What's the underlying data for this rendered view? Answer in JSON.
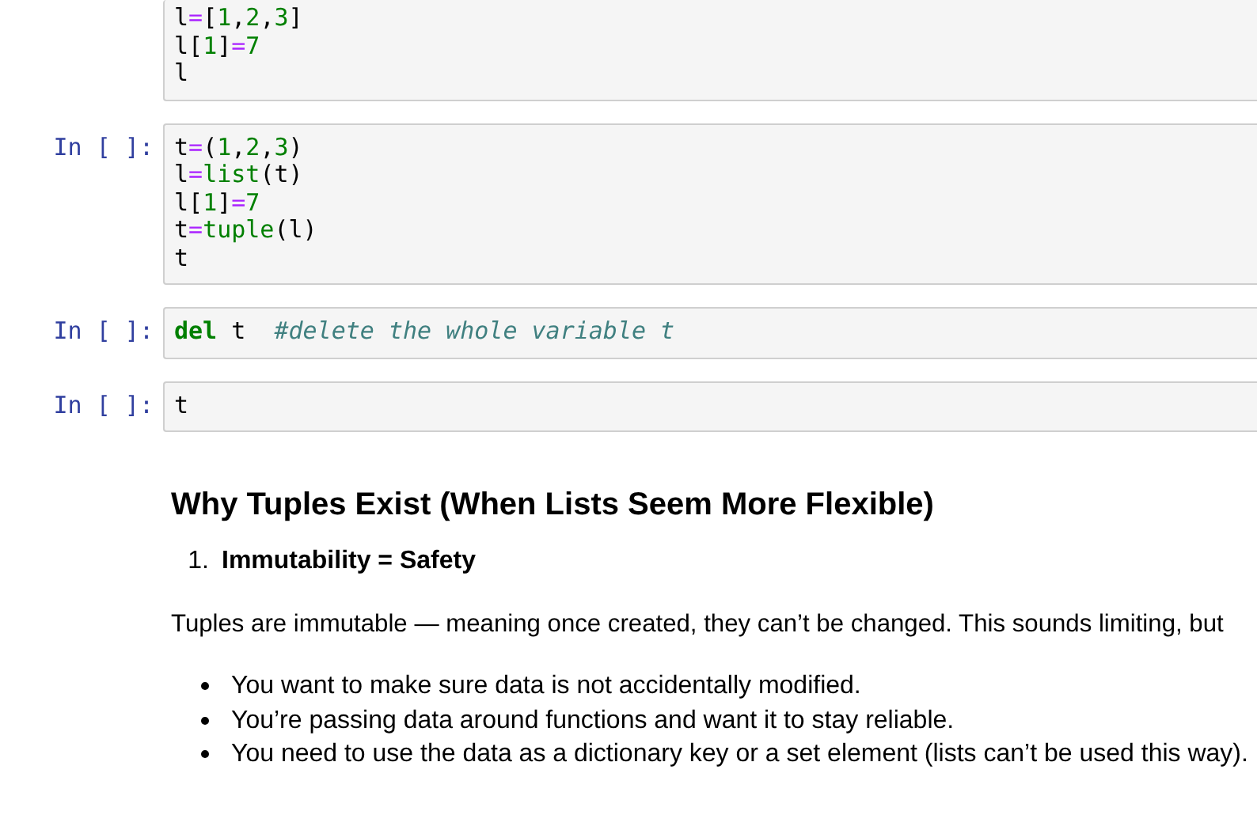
{
  "cells": [
    {
      "lines": [
        [
          {
            "text": "l",
            "kind": "name"
          },
          {
            "text": "=",
            "kind": "op"
          },
          {
            "text": "[",
            "kind": "punct"
          },
          {
            "text": "1",
            "kind": "num"
          },
          {
            "text": ",",
            "kind": "punct"
          },
          {
            "text": "2",
            "kind": "num"
          },
          {
            "text": ",",
            "kind": "punct"
          },
          {
            "text": "3",
            "kind": "num"
          },
          {
            "text": "]",
            "kind": "punct"
          }
        ],
        [
          {
            "text": "l",
            "kind": "name"
          },
          {
            "text": "[",
            "kind": "punct"
          },
          {
            "text": "1",
            "kind": "num"
          },
          {
            "text": "]",
            "kind": "punct"
          },
          {
            "text": "=",
            "kind": "op"
          },
          {
            "text": "7",
            "kind": "num"
          }
        ],
        [
          {
            "text": "l",
            "kind": "name"
          }
        ]
      ]
    },
    {
      "prompt": "In [ ]:",
      "lines": [
        [
          {
            "text": "t",
            "kind": "name"
          },
          {
            "text": "=",
            "kind": "op"
          },
          {
            "text": "(",
            "kind": "punct"
          },
          {
            "text": "1",
            "kind": "num"
          },
          {
            "text": ",",
            "kind": "punct"
          },
          {
            "text": "2",
            "kind": "num"
          },
          {
            "text": ",",
            "kind": "punct"
          },
          {
            "text": "3",
            "kind": "num"
          },
          {
            "text": ")",
            "kind": "punct"
          }
        ],
        [
          {
            "text": "l",
            "kind": "name"
          },
          {
            "text": "=",
            "kind": "op"
          },
          {
            "text": "list",
            "kind": "builtin"
          },
          {
            "text": "(t)",
            "kind": "punct"
          }
        ],
        [
          {
            "text": "l",
            "kind": "name"
          },
          {
            "text": "[",
            "kind": "punct"
          },
          {
            "text": "1",
            "kind": "num"
          },
          {
            "text": "]",
            "kind": "punct"
          },
          {
            "text": "=",
            "kind": "op"
          },
          {
            "text": "7",
            "kind": "num"
          }
        ],
        [
          {
            "text": "t",
            "kind": "name"
          },
          {
            "text": "=",
            "kind": "op"
          },
          {
            "text": "tuple",
            "kind": "builtin"
          },
          {
            "text": "(l)",
            "kind": "punct"
          }
        ],
        [
          {
            "text": "t",
            "kind": "name"
          }
        ]
      ]
    },
    {
      "prompt": "In [ ]:",
      "lines": [
        [
          {
            "text": "del",
            "kind": "keyword"
          },
          {
            "text": " t  ",
            "kind": "name"
          },
          {
            "text": "#delete the whole variable t",
            "kind": "comment"
          }
        ]
      ]
    },
    {
      "prompt": "In [ ]:",
      "lines": [
        [
          {
            "text": "t",
            "kind": "name"
          }
        ]
      ]
    }
  ],
  "markdown": {
    "heading": "Why Tuples Exist (When Lists Seem More Flexible)",
    "numbered": [
      {
        "number": "1.",
        "text": "Immutability = Safety"
      }
    ],
    "paragraph": "Tuples are immutable — meaning once created, they can’t be changed. This sounds limiting, but",
    "bullets": [
      "You want to make sure data is not accidentally modified.",
      "You’re passing data around functions and want it to stay reliable.",
      "You need to use the data as a dictionary key or a set element (lists can’t be used this way)."
    ]
  }
}
